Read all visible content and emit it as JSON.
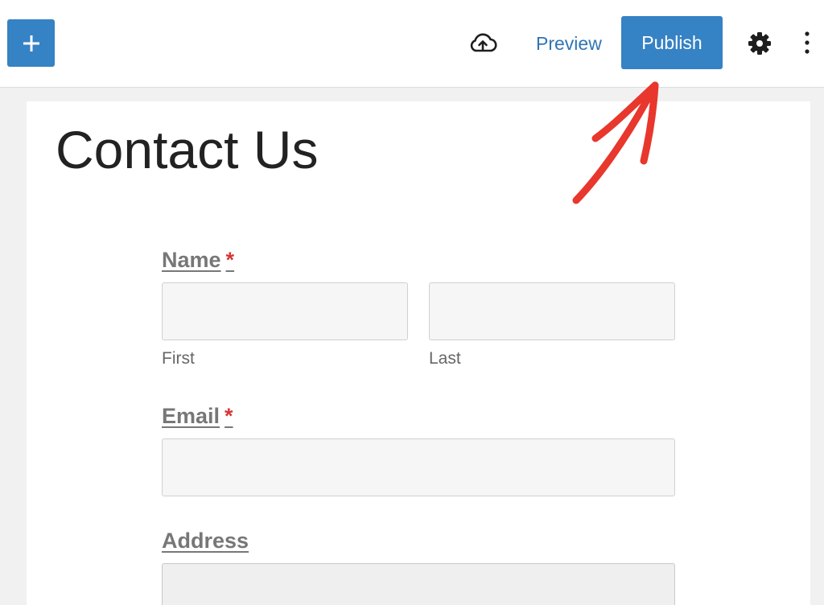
{
  "toolbar": {
    "add_icon": "plus-icon",
    "save_icon": "cloud-upload-icon",
    "preview_label": "Preview",
    "publish_label": "Publish",
    "settings_icon": "gear-icon",
    "options_icon": "vertical-ellipsis-icon",
    "accent_color": "#3582c4"
  },
  "page": {
    "title": "Contact Us"
  },
  "form": {
    "required_marker": "*",
    "name": {
      "label": "Name",
      "first_sublabel": "First",
      "last_sublabel": "Last",
      "first_value": "",
      "last_value": ""
    },
    "email": {
      "label": "Email",
      "value": ""
    },
    "address": {
      "label": "Address",
      "value": ""
    }
  },
  "annotation": {
    "arrow_color": "#e8372c"
  }
}
